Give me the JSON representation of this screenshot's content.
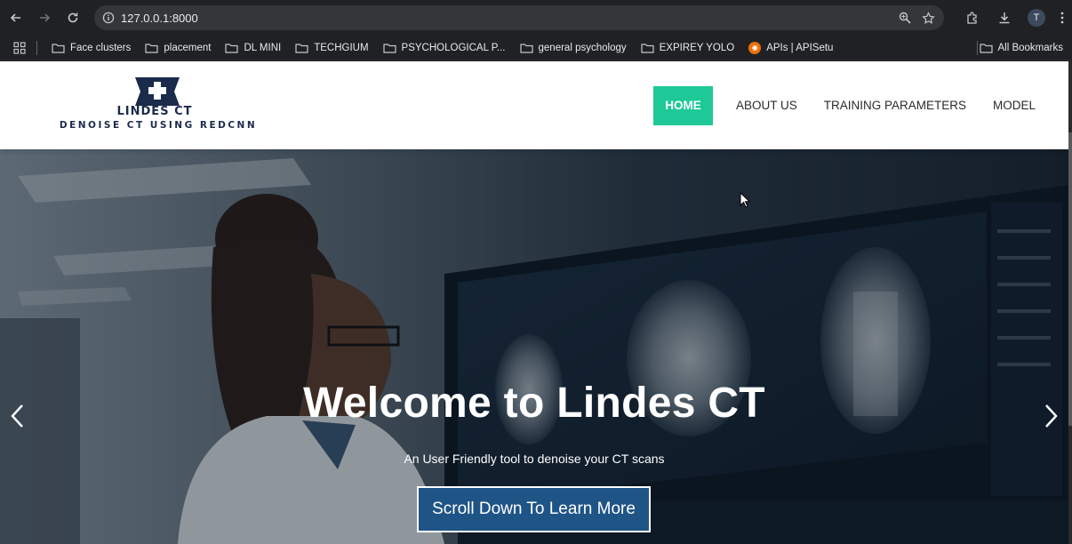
{
  "browser": {
    "url": "127.0.0.1:8000",
    "profile_initial": "T",
    "bookmarks": [
      {
        "label": "Face clusters",
        "icon": "folder-icon"
      },
      {
        "label": "placement",
        "icon": "folder-icon"
      },
      {
        "label": "DL MINI",
        "icon": "folder-icon"
      },
      {
        "label": "TECHGIUM",
        "icon": "folder-icon"
      },
      {
        "label": "PSYCHOLOGICAL P...",
        "icon": "folder-icon"
      },
      {
        "label": "general psychology",
        "icon": "folder-icon"
      },
      {
        "label": "EXPIREY YOLO",
        "icon": "folder-icon"
      },
      {
        "label": "APIs | APISetu",
        "icon": "apisetu-icon"
      }
    ],
    "all_bookmarks": "All Bookmarks"
  },
  "site": {
    "logo_name": "LINDES CT",
    "logo_tagline": "DENOISE CT USING REDCNN",
    "nav": [
      {
        "label": "HOME",
        "active": true
      },
      {
        "label": "ABOUT US",
        "active": false
      },
      {
        "label": "TRAINING PARAMETERS",
        "active": false
      },
      {
        "label": "MODEL",
        "active": false
      }
    ],
    "accent_color": "#1ec997",
    "button_color": "#1f5486"
  },
  "hero": {
    "title": "Welcome to Lindes CT",
    "subtitle": "An User Friendly tool to denoise your CT scans",
    "cta_label": "Scroll Down To Learn More"
  }
}
